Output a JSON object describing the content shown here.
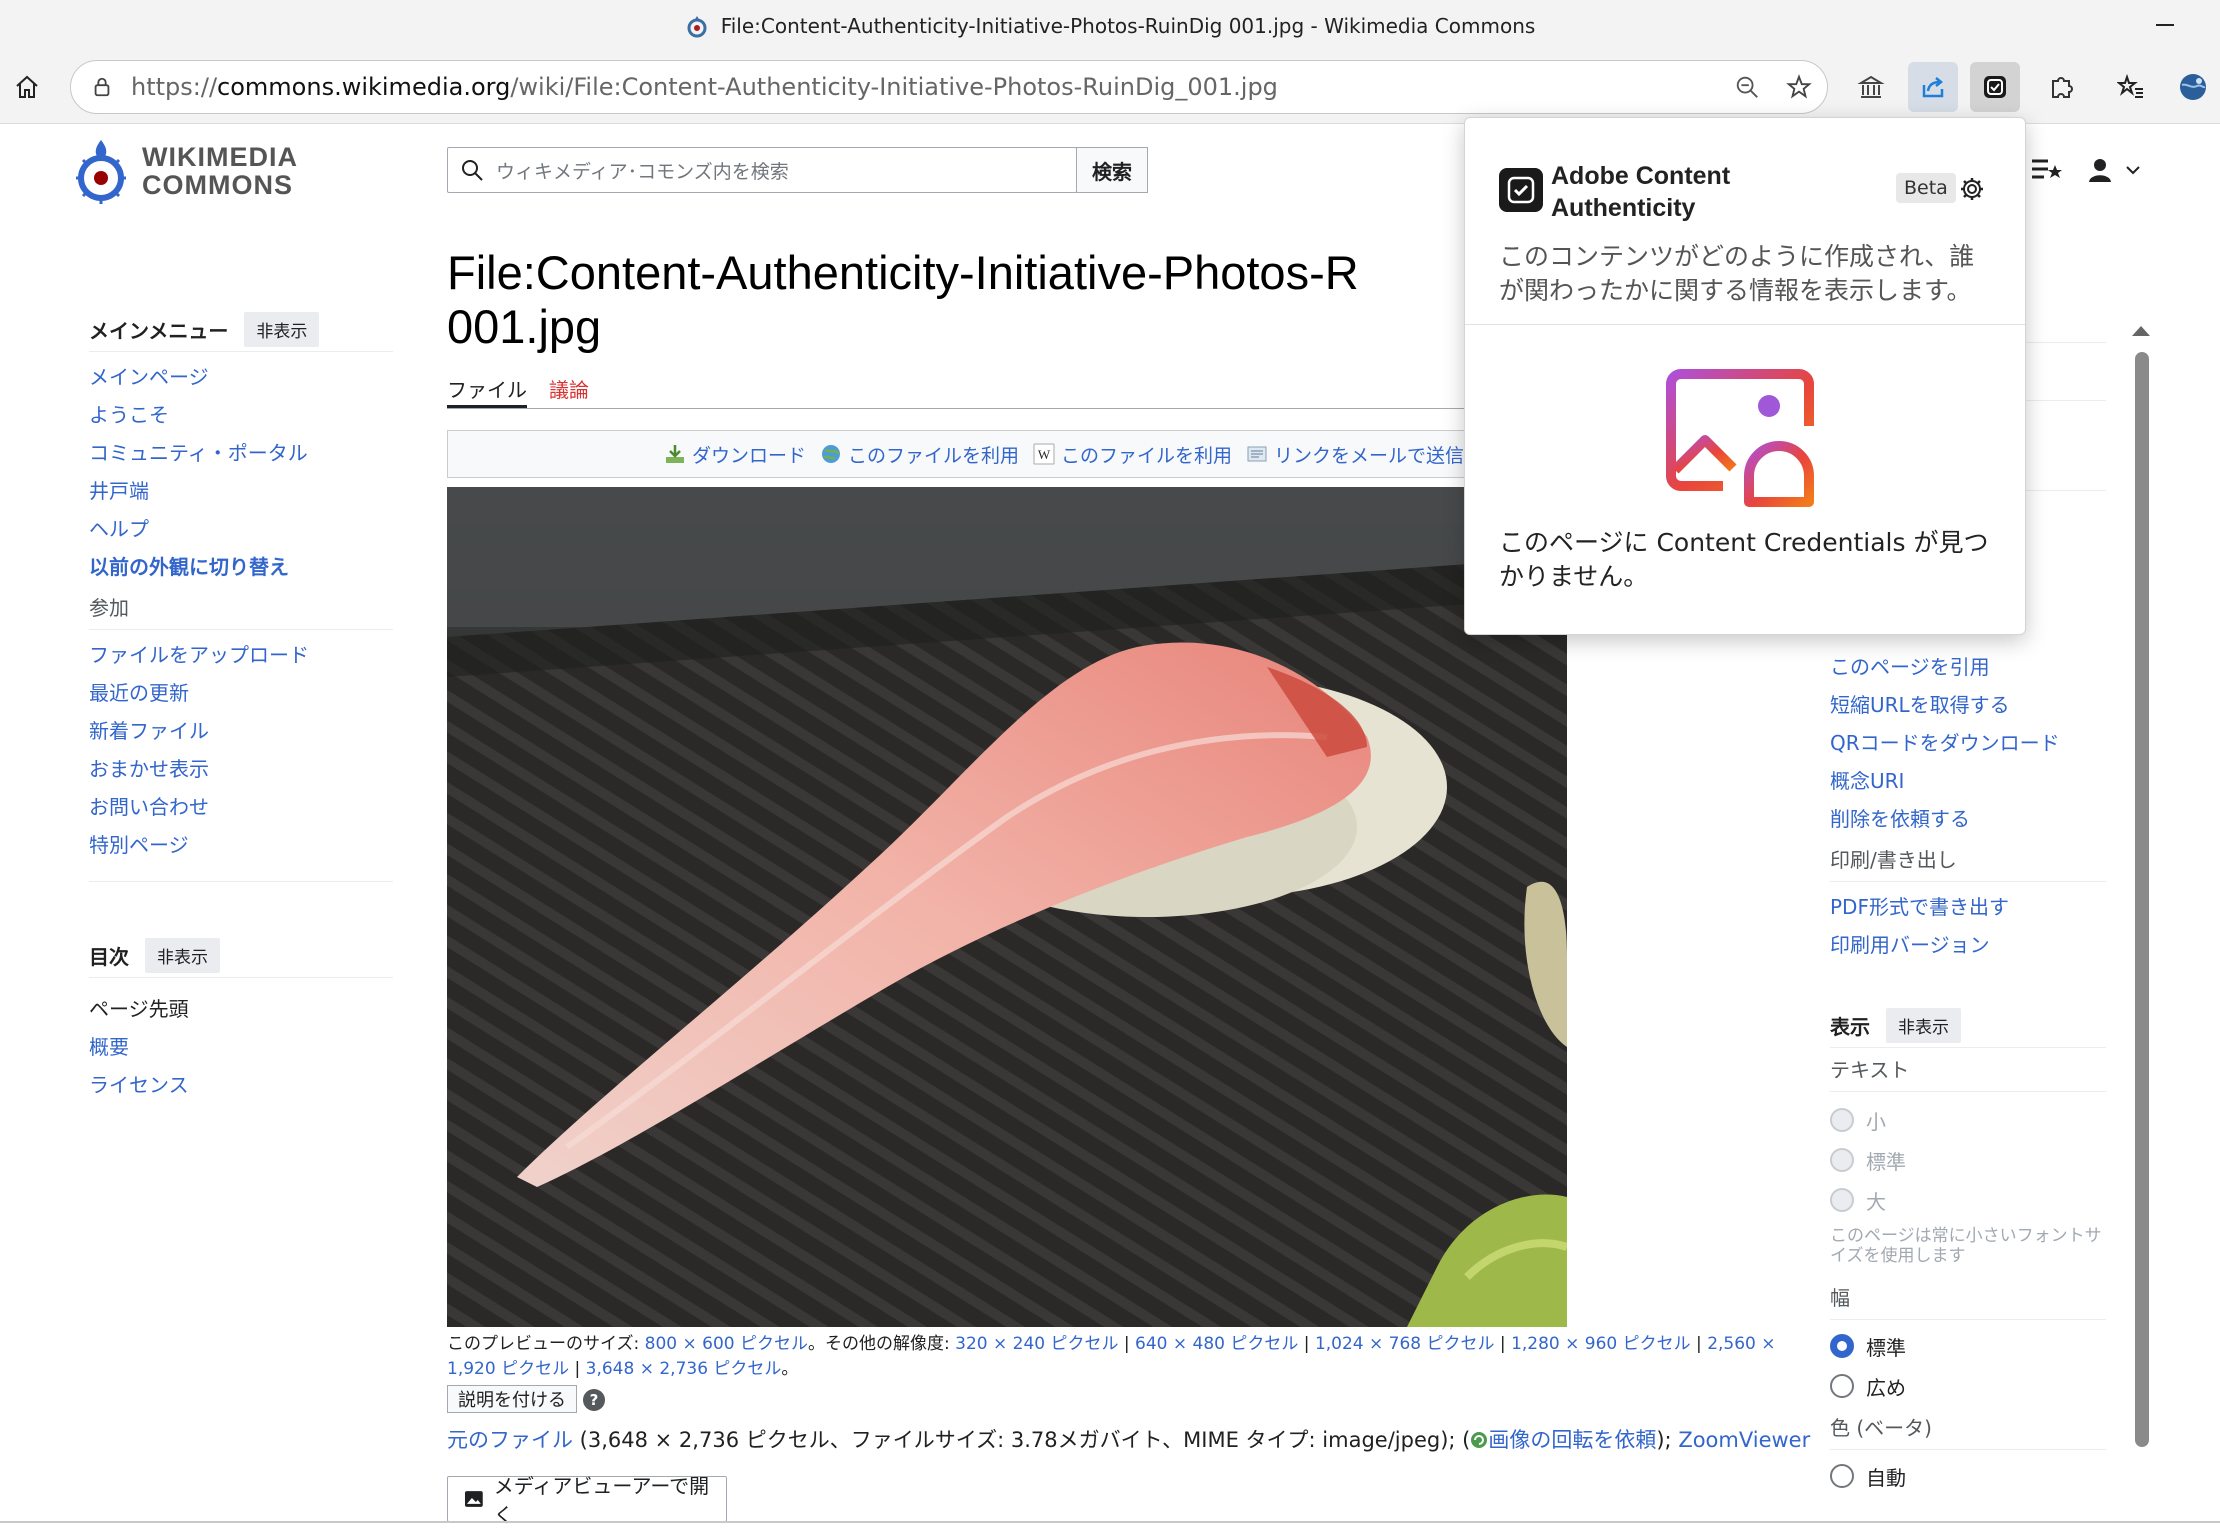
{
  "window": {
    "title": "File:Content-Authenticity-Initiative-Photos-RuinDig 001.jpg - Wikimedia Commons"
  },
  "address_bar": {
    "url_prefix": "https://",
    "url_domain": "commons.wikimedia.org",
    "url_path": "/wiki/File:Content-Authenticity-Initiative-Photos-RuinDig_001.jpg"
  },
  "site": {
    "logo_line1": "WIKIMEDIA",
    "logo_line2": "COMMONS"
  },
  "search": {
    "placeholder": "ウィキメディア･コモンズ内を検索",
    "button": "検索"
  },
  "left_sidebar": {
    "main_menu": {
      "title": "メインメニュー",
      "hide": "非表示",
      "items": [
        "メインページ",
        "ようこそ",
        "コミュニティ・ポータル",
        "井戸端",
        "ヘルプ",
        "以前の外観に切り替え"
      ]
    },
    "participate": {
      "label": "参加",
      "items": [
        "ファイルをアップロード",
        "最近の更新",
        "新着ファイル",
        "おまかせ表示",
        "お問い合わせ",
        "特別ページ"
      ]
    },
    "toc": {
      "title": "目次",
      "hide": "非表示",
      "items": [
        "ページ先頭",
        "概要",
        "ライセンス"
      ]
    }
  },
  "page": {
    "title_line1": "File:Content-Authenticity-Initiative-Photos-R",
    "title_line2": "001.jpg",
    "tabs": [
      "ファイル",
      "議論"
    ],
    "actions": [
      "ダウンロード",
      "このファイルを利用",
      "このファイルを利用",
      "リンクをメールで送信"
    ],
    "caption": {
      "preview_prefix": "このプレビューのサイズ: ",
      "preview_size": "800 × 600 ピクセル",
      "other_prefix": "。その他の解像度: ",
      "res1": "320 × 240 ピクセル",
      "res2": "640 × 480 ピクセル",
      "res3": "1,024 × 768 ピクセル",
      "res4": "1,280 × 960 ピクセル",
      "res5": "2,560 × 1,920 ピクセル",
      "res6": "3,648 × 2,736 ピクセル",
      "sep": " | ",
      "end": "。"
    },
    "describe_button": "説明を付ける",
    "help_mark": "?",
    "original": {
      "link": "元のファイル",
      "details": " (3,648 × 2,736 ピクセル、ファイルサイズ: 3.78メガバイト、MIME タイプ: image/jpeg); (",
      "rotate": "画像の回転を依頼",
      "sep": "); ",
      "zoom": "ZoomViewer"
    },
    "media_viewer_button": "メディアビューアーで開く"
  },
  "right_sidebar": {
    "links": [
      "このページを引用",
      "短縮URLを取得する",
      "QRコードをダウンロード",
      "概念URI",
      "削除を依頼する"
    ],
    "print_label": "印刷/書き出し",
    "print_items": [
      "PDF形式で書き出す",
      "印刷用バージョン"
    ],
    "display": {
      "title": "表示",
      "hide": "非表示",
      "text_label": "テキスト",
      "text_options": [
        "小",
        "標準",
        "大"
      ],
      "note": "このページは常に小さいフォントサイズを使用します",
      "width_label": "幅",
      "width_options": [
        "標準",
        "広め"
      ],
      "color_label": "色 (ベータ)",
      "color_options": [
        "自動"
      ]
    }
  },
  "popup": {
    "title": "Adobe Content Authenticity",
    "beta": "Beta",
    "description": "このコンテンツがどのように作成され、誰が関わったかに関する情報を表示します。",
    "no_credentials": "このページに Content Credentials が見つかりません。"
  },
  "colors": {
    "link": "#3366cc",
    "red_link": "#d73333",
    "accent_active": "#3366cc"
  }
}
